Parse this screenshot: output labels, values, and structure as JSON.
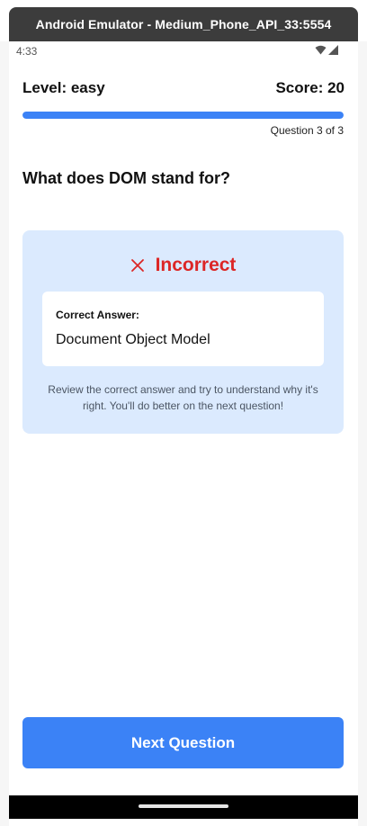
{
  "window": {
    "title": "Android Emulator - Medium_Phone_API_33:5554"
  },
  "statusbar": {
    "time": "4:33",
    "icons": [
      "wifi-icon",
      "signal-icon"
    ]
  },
  "quiz": {
    "level_label": "Level: easy",
    "score_label": "Score: 20",
    "progress": {
      "current": 3,
      "total": 3,
      "fraction": 1.0
    },
    "question_counter": "Question 3 of 3",
    "question": "What does DOM stand for?"
  },
  "feedback": {
    "status_icon": "close-icon",
    "status": "Incorrect",
    "correct_answer_title": "Correct Answer:",
    "correct_answer": "Document Object Model",
    "hint": "Review the correct answer and try to understand why it's right. You'll do better on the next question!"
  },
  "actions": {
    "next_label": "Next Question"
  },
  "colors": {
    "accent": "#3b82f6",
    "incorrect": "#dc2626",
    "card_background": "#dbeafe"
  }
}
